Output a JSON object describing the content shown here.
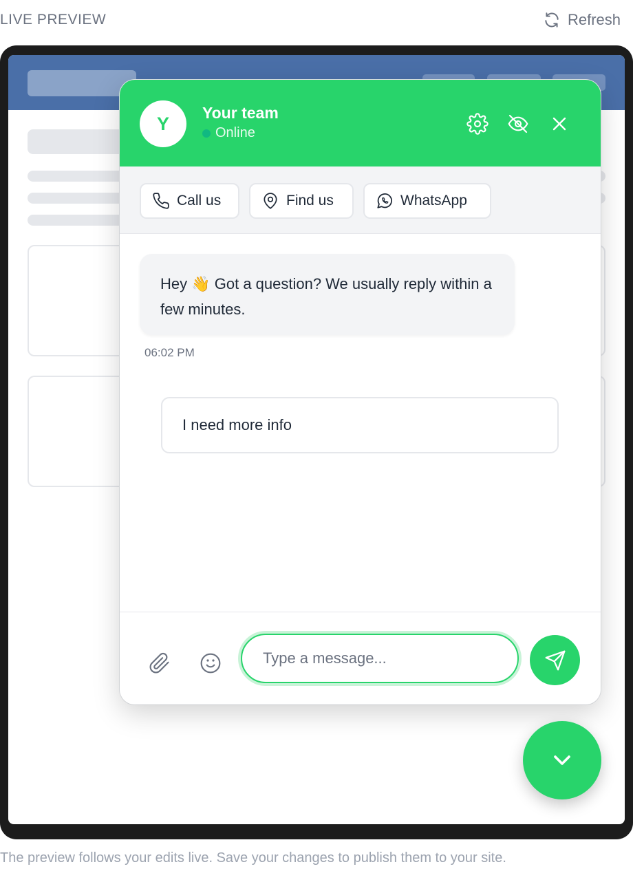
{
  "topbar": {
    "label": "LIVE PREVIEW",
    "refresh_label": "Refresh",
    "refresh_icon": "refresh-icon"
  },
  "chat": {
    "avatar_letter": "Y",
    "team_name": "Your team",
    "status": "Online",
    "header_icons": [
      "gear-icon",
      "eye-off-icon",
      "close-icon"
    ],
    "actions": [
      {
        "label": "Call us",
        "icon": "phone-icon"
      },
      {
        "label": "Find us",
        "icon": "map-pin-icon"
      },
      {
        "label": "WhatsApp",
        "icon": "whatsapp-icon"
      }
    ],
    "message": {
      "text": "Hey 👋  Got a question? We usually reply within a few minutes.",
      "time": "06:02 PM"
    },
    "quick_reply": "I need more info",
    "composer": {
      "placeholder": "Type a message...",
      "icons": [
        "paperclip-icon",
        "emoji-icon",
        "send-icon"
      ]
    },
    "toggle_icon": "chevron-down-icon"
  },
  "footer": {
    "note": "The preview follows your edits live. Save your changes to publish them to your site."
  },
  "colors": {
    "accent": "#28d46b",
    "site_header": "#4a6fa8",
    "status_dot": "#10b981"
  }
}
